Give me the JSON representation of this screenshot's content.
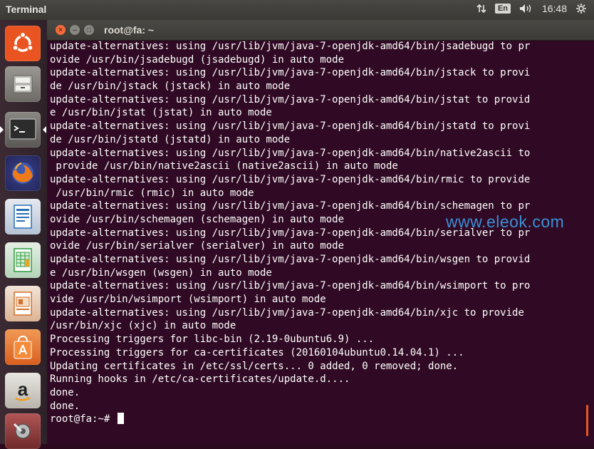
{
  "panel": {
    "app_title": "Terminal",
    "language": "En",
    "time": "16:48",
    "icons": [
      "network-updown-icon",
      "keyboard-language-icon",
      "volume-icon",
      "settings-gear-icon"
    ]
  },
  "launcher": {
    "items": [
      {
        "name": "ubuntu-dash",
        "icon": "ubuntu-logo-icon",
        "color": "#e95420"
      },
      {
        "name": "files",
        "icon": "file-cabinet-icon",
        "color": "#8a8a86"
      },
      {
        "name": "terminal",
        "icon": "terminal-icon",
        "color": "#2e2e2e",
        "active": true
      },
      {
        "name": "firefox",
        "icon": "firefox-icon",
        "color": "#e66000"
      },
      {
        "name": "libreoffice-writer",
        "icon": "writer-doc-icon",
        "color": "#2a6fb5"
      },
      {
        "name": "libreoffice-calc",
        "icon": "calc-sheet-icon",
        "color": "#2e9b3e"
      },
      {
        "name": "libreoffice-impress",
        "icon": "impress-slides-icon",
        "color": "#d4702a"
      },
      {
        "name": "software-center",
        "icon": "shopping-bag-icon",
        "color": "#e57a2e"
      },
      {
        "name": "amazon",
        "icon": "amazon-a-icon",
        "color": "#c9c5bd"
      },
      {
        "name": "system-settings",
        "icon": "settings-wrench-icon",
        "color": "#8a3b3b"
      }
    ]
  },
  "window": {
    "title": "root@fa: ~",
    "buttons": {
      "close": "×",
      "minimize": "–",
      "maximize": "□"
    }
  },
  "terminal": {
    "lines": [
      "update-alternatives: using /usr/lib/jvm/java-7-openjdk-amd64/bin/jsadebugd to pr",
      "ovide /usr/bin/jsadebugd (jsadebugd) in auto mode",
      "update-alternatives: using /usr/lib/jvm/java-7-openjdk-amd64/bin/jstack to provi",
      "de /usr/bin/jstack (jstack) in auto mode",
      "update-alternatives: using /usr/lib/jvm/java-7-openjdk-amd64/bin/jstat to provid",
      "e /usr/bin/jstat (jstat) in auto mode",
      "update-alternatives: using /usr/lib/jvm/java-7-openjdk-amd64/bin/jstatd to provi",
      "de /usr/bin/jstatd (jstatd) in auto mode",
      "update-alternatives: using /usr/lib/jvm/java-7-openjdk-amd64/bin/native2ascii to",
      " provide /usr/bin/native2ascii (native2ascii) in auto mode",
      "update-alternatives: using /usr/lib/jvm/java-7-openjdk-amd64/bin/rmic to provide",
      " /usr/bin/rmic (rmic) in auto mode",
      "update-alternatives: using /usr/lib/jvm/java-7-openjdk-amd64/bin/schemagen to pr",
      "ovide /usr/bin/schemagen (schemagen) in auto mode",
      "update-alternatives: using /usr/lib/jvm/java-7-openjdk-amd64/bin/serialver to pr",
      "ovide /usr/bin/serialver (serialver) in auto mode",
      "update-alternatives: using /usr/lib/jvm/java-7-openjdk-amd64/bin/wsgen to provid",
      "e /usr/bin/wsgen (wsgen) in auto mode",
      "update-alternatives: using /usr/lib/jvm/java-7-openjdk-amd64/bin/wsimport to pro",
      "vide /usr/bin/wsimport (wsimport) in auto mode",
      "update-alternatives: using /usr/lib/jvm/java-7-openjdk-amd64/bin/xjc to provide",
      "/usr/bin/xjc (xjc) in auto mode",
      "Processing triggers for libc-bin (2.19-0ubuntu6.9) ...",
      "Processing triggers for ca-certificates (20160104ubuntu0.14.04.1) ...",
      "Updating certificates in /etc/ssl/certs... 0 added, 0 removed; done.",
      "Running hooks in /etc/ca-certificates/update.d....",
      "done.",
      "done."
    ],
    "prompt": "root@fa:~# "
  },
  "watermark": "www.eleok.com",
  "colors": {
    "terminal_bg": "#300a24",
    "accent": "#e95420",
    "watermark": "#3b8fd6"
  }
}
